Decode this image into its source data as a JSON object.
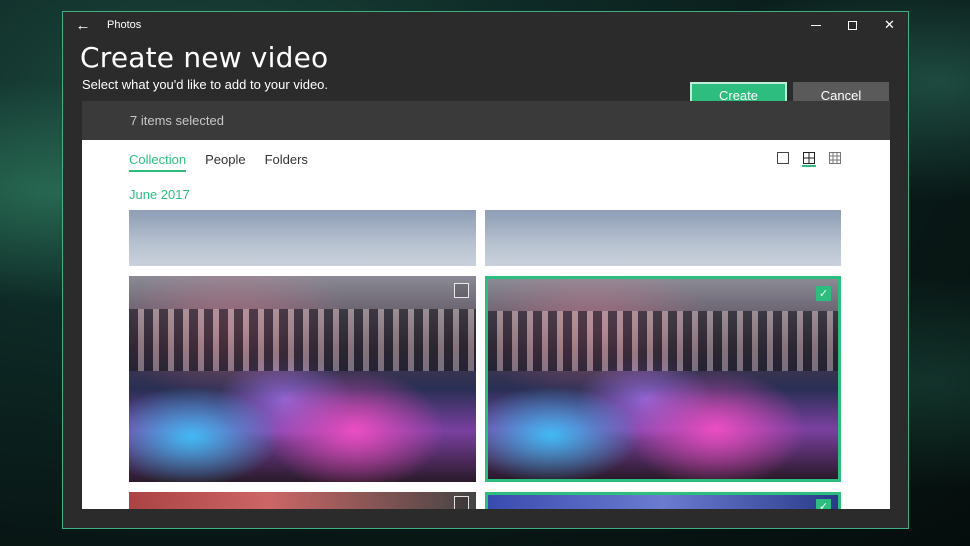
{
  "window": {
    "app_title": "Photos"
  },
  "header": {
    "title": "Create new video",
    "subtitle": "Select what you'd like to add to your video.",
    "create_label": "Create",
    "cancel_label": "Cancel"
  },
  "selection": {
    "status": "7 items selected"
  },
  "tabs": [
    {
      "label": "Collection",
      "active": true
    },
    {
      "label": "People",
      "active": false
    },
    {
      "label": "Folders",
      "active": false
    }
  ],
  "view_modes": [
    "large-tiles-icon",
    "medium-tiles-icon",
    "small-tiles-icon"
  ],
  "groups": [
    {
      "date_label": "June 2017"
    }
  ],
  "check_glyph": "✓",
  "colors": {
    "accent": "#2dbd7e",
    "window_bg": "#2b2b2b",
    "selection_bar": "#3a3a3a",
    "cancel_bg": "#5a5a5a"
  }
}
